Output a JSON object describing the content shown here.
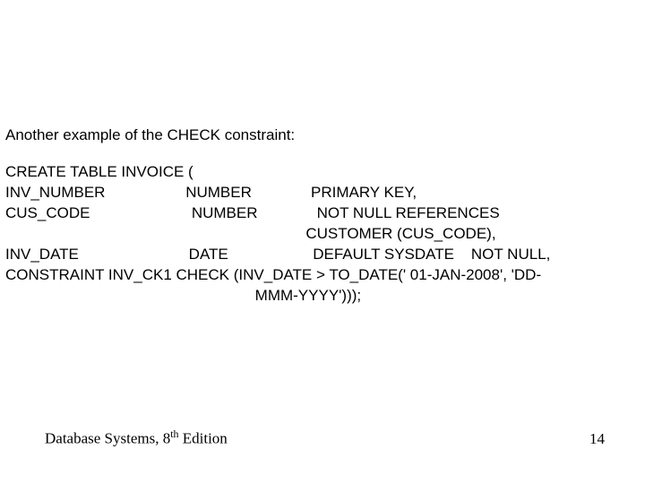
{
  "intro": "Another example of the CHECK constraint:",
  "sql_lines": {
    "l1": "CREATE TABLE INVOICE (",
    "l2": "INV_NUMBER                   NUMBER              PRIMARY KEY,",
    "l3": "CUS_CODE                        NUMBER              NOT NULL REFERENCES",
    "l4": "                                                                       CUSTOMER (CUS_CODE),",
    "l5": "INV_DATE                          DATE                    DEFAULT SYSDATE    NOT NULL,",
    "l6": "CONSTRAINT INV_CK1 CHECK (INV_DATE > TO_DATE(' 01-JAN-2008', 'DD-",
    "l7": "                                                           MMM-YYYY')));"
  },
  "footer": {
    "book_prefix": "Database Systems, 8",
    "book_suffix": " Edition",
    "th": "th",
    "page": "14"
  }
}
